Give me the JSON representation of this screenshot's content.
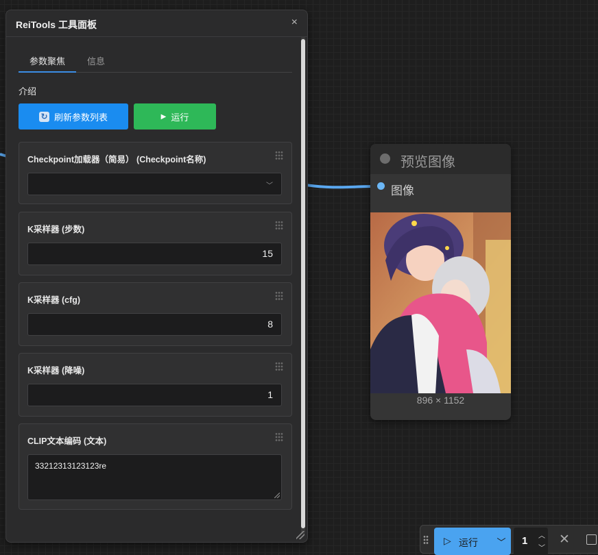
{
  "panel": {
    "title": "ReiTools 工具面板",
    "close": "×",
    "tabs": [
      {
        "label": "参数聚焦",
        "active": true
      },
      {
        "label": "信息",
        "active": false
      }
    ],
    "intro_label": "介绍",
    "buttons": {
      "refresh": "刷新参数列表",
      "run": "运行"
    },
    "params": [
      {
        "label": "Checkpoint加载器（简易） (Checkpoint名称)",
        "type": "select",
        "value": ""
      },
      {
        "label": "K采样器 (步数)",
        "type": "number",
        "value": "15"
      },
      {
        "label": "K采样器 (cfg)",
        "type": "number",
        "value": "8"
      },
      {
        "label": "K采样器 (降噪)",
        "type": "number",
        "value": "1"
      },
      {
        "label": "CLIP文本编码 (文本)",
        "type": "textarea",
        "value": "33212313123123re"
      }
    ]
  },
  "preview_node": {
    "title": "预览图像",
    "input_label": "图像",
    "image_size": "896 × 1152"
  },
  "toolbar": {
    "run_label": "运行",
    "count": "1"
  },
  "colors": {
    "accent_blue": "#1a8cf0",
    "run_green": "#2eb858",
    "wire": "#5aa7ef"
  }
}
